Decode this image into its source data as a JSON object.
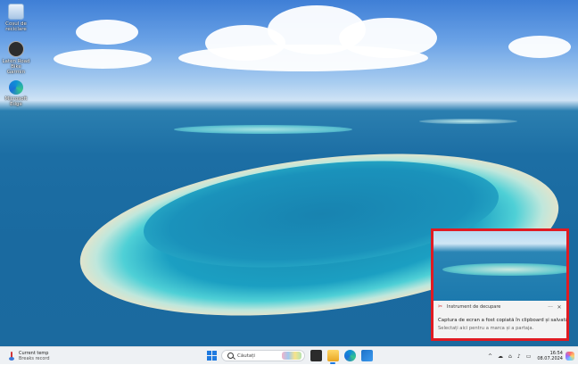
{
  "desktop": {
    "icons": [
      {
        "label": "Coșul de reciclare",
        "icon": "recycle-bin-icon"
      },
      {
        "label": "Laten Road Bike Garmin",
        "icon": "app-icon"
      },
      {
        "label": "Microsoft Edge",
        "icon": "edge-icon"
      }
    ]
  },
  "notification": {
    "app_name": "Instrument de decupare",
    "more_label": "···",
    "close_label": "✕",
    "title": "Captura de ecran a fost copiată în clipboard și salvată",
    "body": "Selectați aici pentru a marca și a partaja.",
    "highlight_color": "#e01b22"
  },
  "taskbar": {
    "weather": {
      "title": "Current temp",
      "subtitle": "Breaks record"
    },
    "search": {
      "placeholder": "Căutați"
    },
    "apps": [
      "start-icon",
      "task-view-icon",
      "file-explorer-icon",
      "edge-icon",
      "store-icon"
    ],
    "tray": {
      "chevron": "^",
      "time": "16:54",
      "date": "08.07.2024"
    }
  }
}
